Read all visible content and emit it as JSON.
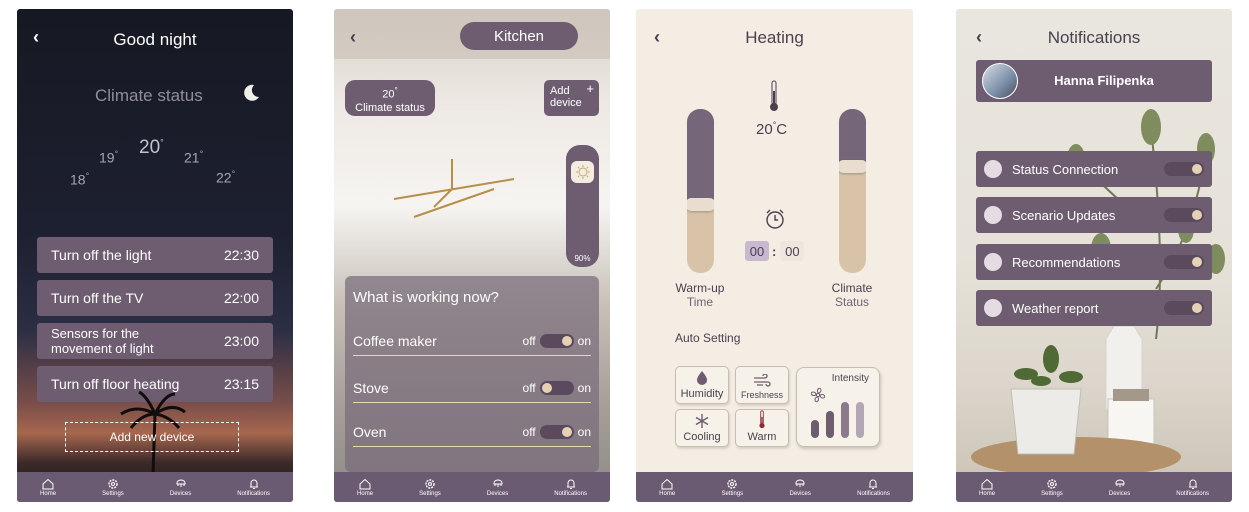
{
  "nav": {
    "home": "Home",
    "settings": "Settings",
    "devices": "Devices",
    "notifications": "Notifications"
  },
  "screen1": {
    "title": "Good night",
    "climate_status": "Climate status",
    "temps": {
      "t18": "18",
      "t19": "19",
      "t20": "20",
      "t21": "21",
      "t22": "22"
    },
    "tasks": [
      {
        "label": "Turn off the light",
        "time": "22:30"
      },
      {
        "label": "Turn off the TV",
        "time": "22:00"
      },
      {
        "label": "Sensors for the movement of light",
        "time": "23:00"
      },
      {
        "label": "Turn off floor heating",
        "time": "23:15"
      }
    ],
    "add_device": "Add new device"
  },
  "screen2": {
    "room": "Kitchen",
    "climate_value": "20",
    "climate_label": "Climate status",
    "add_device": "Add device",
    "light_level": "90%",
    "panel_title": "What is working now?",
    "off_label": "off",
    "on_label": "on",
    "devices": [
      {
        "name": "Coffee maker",
        "state": "on"
      },
      {
        "name": "Stove",
        "state": "off"
      },
      {
        "name": "Oven",
        "state": "on"
      }
    ]
  },
  "screen3": {
    "title": "Heating",
    "temperature": "20",
    "temperature_unit": "C",
    "warmup_label": "Warm-up",
    "warmup_sub": "Time",
    "warmup_level": 0.58,
    "climate_label": "Climate",
    "climate_sub": "Status",
    "climate_level": 0.35,
    "timer_hours": "00",
    "timer_minutes": "00",
    "auto_setting": "Auto Setting",
    "modes": {
      "humidity": "Humidity",
      "freshness": "Freshness",
      "cooling": "Cooling",
      "warm": "Warm"
    },
    "intensity": "Intensity",
    "intensity_levels": [
      2,
      3,
      4,
      4
    ],
    "colors": {
      "accent": "#6e5d70",
      "sand": "#d8c3a8"
    }
  },
  "screen4": {
    "title": "Notifications",
    "user_name": "Hanna Filipenka",
    "items": [
      {
        "label": "Status Connection"
      },
      {
        "label": "Scenario Updates"
      },
      {
        "label": "Recommendations"
      },
      {
        "label": "Weather report"
      }
    ]
  }
}
